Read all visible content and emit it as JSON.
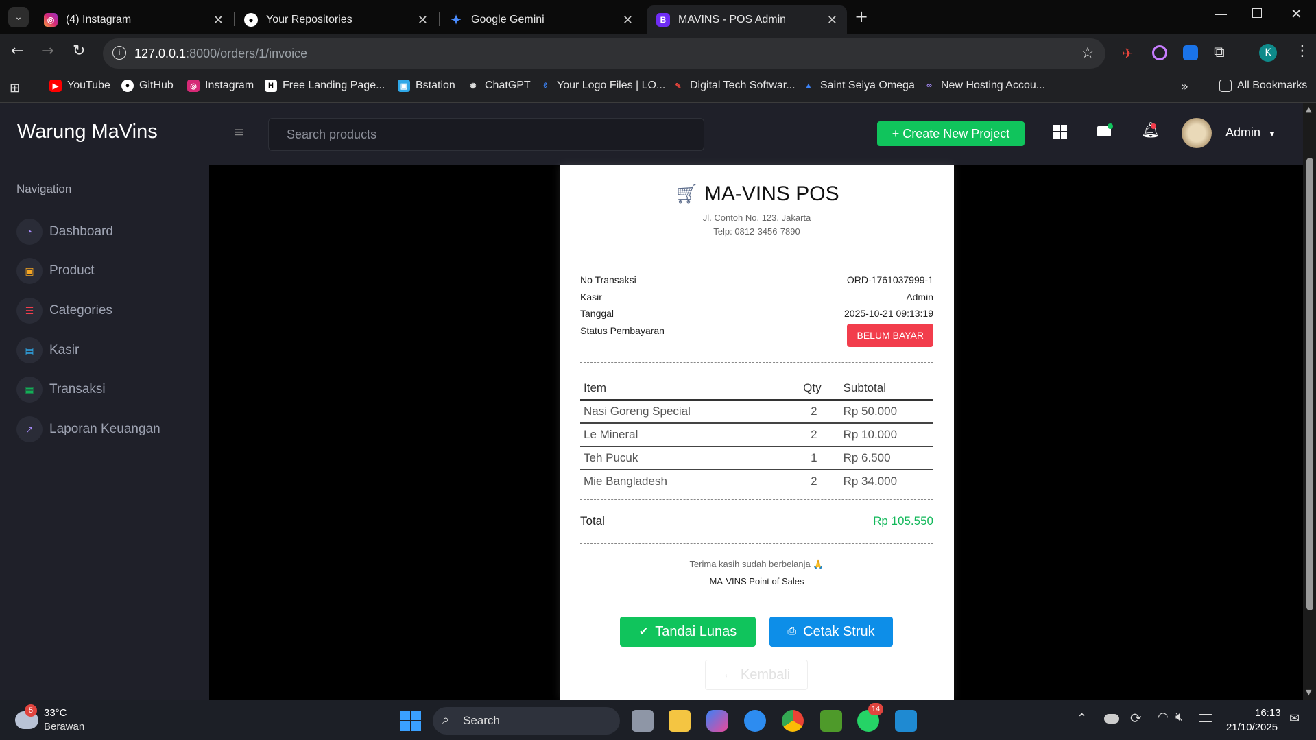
{
  "browser": {
    "tabs": [
      {
        "title": "(4) Instagram",
        "icon": "instagram-icon"
      },
      {
        "title": "Your Repositories",
        "icon": "github-icon"
      },
      {
        "title": "Google Gemini",
        "icon": "gemini-icon"
      },
      {
        "title": "MAVINS - POS Admin",
        "icon": "bootstrap-icon",
        "active": true
      }
    ],
    "url_host": "127.0.0.1",
    "url_rest": ":8000/orders/1/invoice",
    "bookmarks": [
      "YouTube",
      "GitHub",
      "Instagram",
      "Free Landing Page...",
      "Bstation",
      "ChatGPT",
      "Your Logo Files | LO...",
      "Digital Tech Softwar...",
      "Saint Seiya Omega",
      "New Hosting Accou..."
    ],
    "all_bookmarks": "All Bookmarks",
    "profile_initial": "K"
  },
  "app": {
    "brand": "Warung MaVins",
    "search_placeholder": "Search products",
    "create_button": "+ Create New Project",
    "user_name": "Admin",
    "nav_title": "Navigation",
    "nav_items": [
      "Dashboard",
      "Product",
      "Categories",
      "Kasir",
      "Transaksi",
      "Laporan Keuangan"
    ]
  },
  "invoice": {
    "title": "MA-VINS POS",
    "address": "Jl. Contoh No. 123, Jakarta",
    "phone": "Telp: 0812-3456-7890",
    "fields": [
      {
        "label": "No Transaksi",
        "value": "ORD-1761037999-1"
      },
      {
        "label": "Kasir",
        "value": "Admin"
      },
      {
        "label": "Tanggal",
        "value": "2025-10-21 09:13:19"
      },
      {
        "label": "Status Pembayaran",
        "value": ""
      }
    ],
    "status_badge": "BELUM BAYAR",
    "columns": {
      "item": "Item",
      "qty": "Qty",
      "subtotal": "Subtotal"
    },
    "items": [
      {
        "name": "Nasi Goreng Special",
        "qty": "2",
        "subtotal": "Rp 50.000"
      },
      {
        "name": "Le Mineral",
        "qty": "2",
        "subtotal": "Rp 10.000"
      },
      {
        "name": "Teh Pucuk",
        "qty": "1",
        "subtotal": "Rp 6.500"
      },
      {
        "name": "Mie Bangladesh",
        "qty": "2",
        "subtotal": "Rp 34.000"
      }
    ],
    "total_label": "Total",
    "total_value": "Rp 105.550",
    "thanks": "Terima kasih sudah berbelanja 🙏",
    "footer": "MA-VINS Point of Sales",
    "btn_paid": "Tandai Lunas",
    "btn_print": "Cetak Struk",
    "btn_back": "Kembali"
  },
  "taskbar": {
    "temp": "33°C",
    "weather": "Berawan",
    "weather_badge": "5",
    "search": "Search",
    "whatsapp_badge": "14",
    "time": "16:13",
    "date": "21/10/2025"
  },
  "colors": {
    "accent_green": "#10c45c",
    "accent_blue": "#0d8ee8",
    "danger": "#f23d4c"
  }
}
